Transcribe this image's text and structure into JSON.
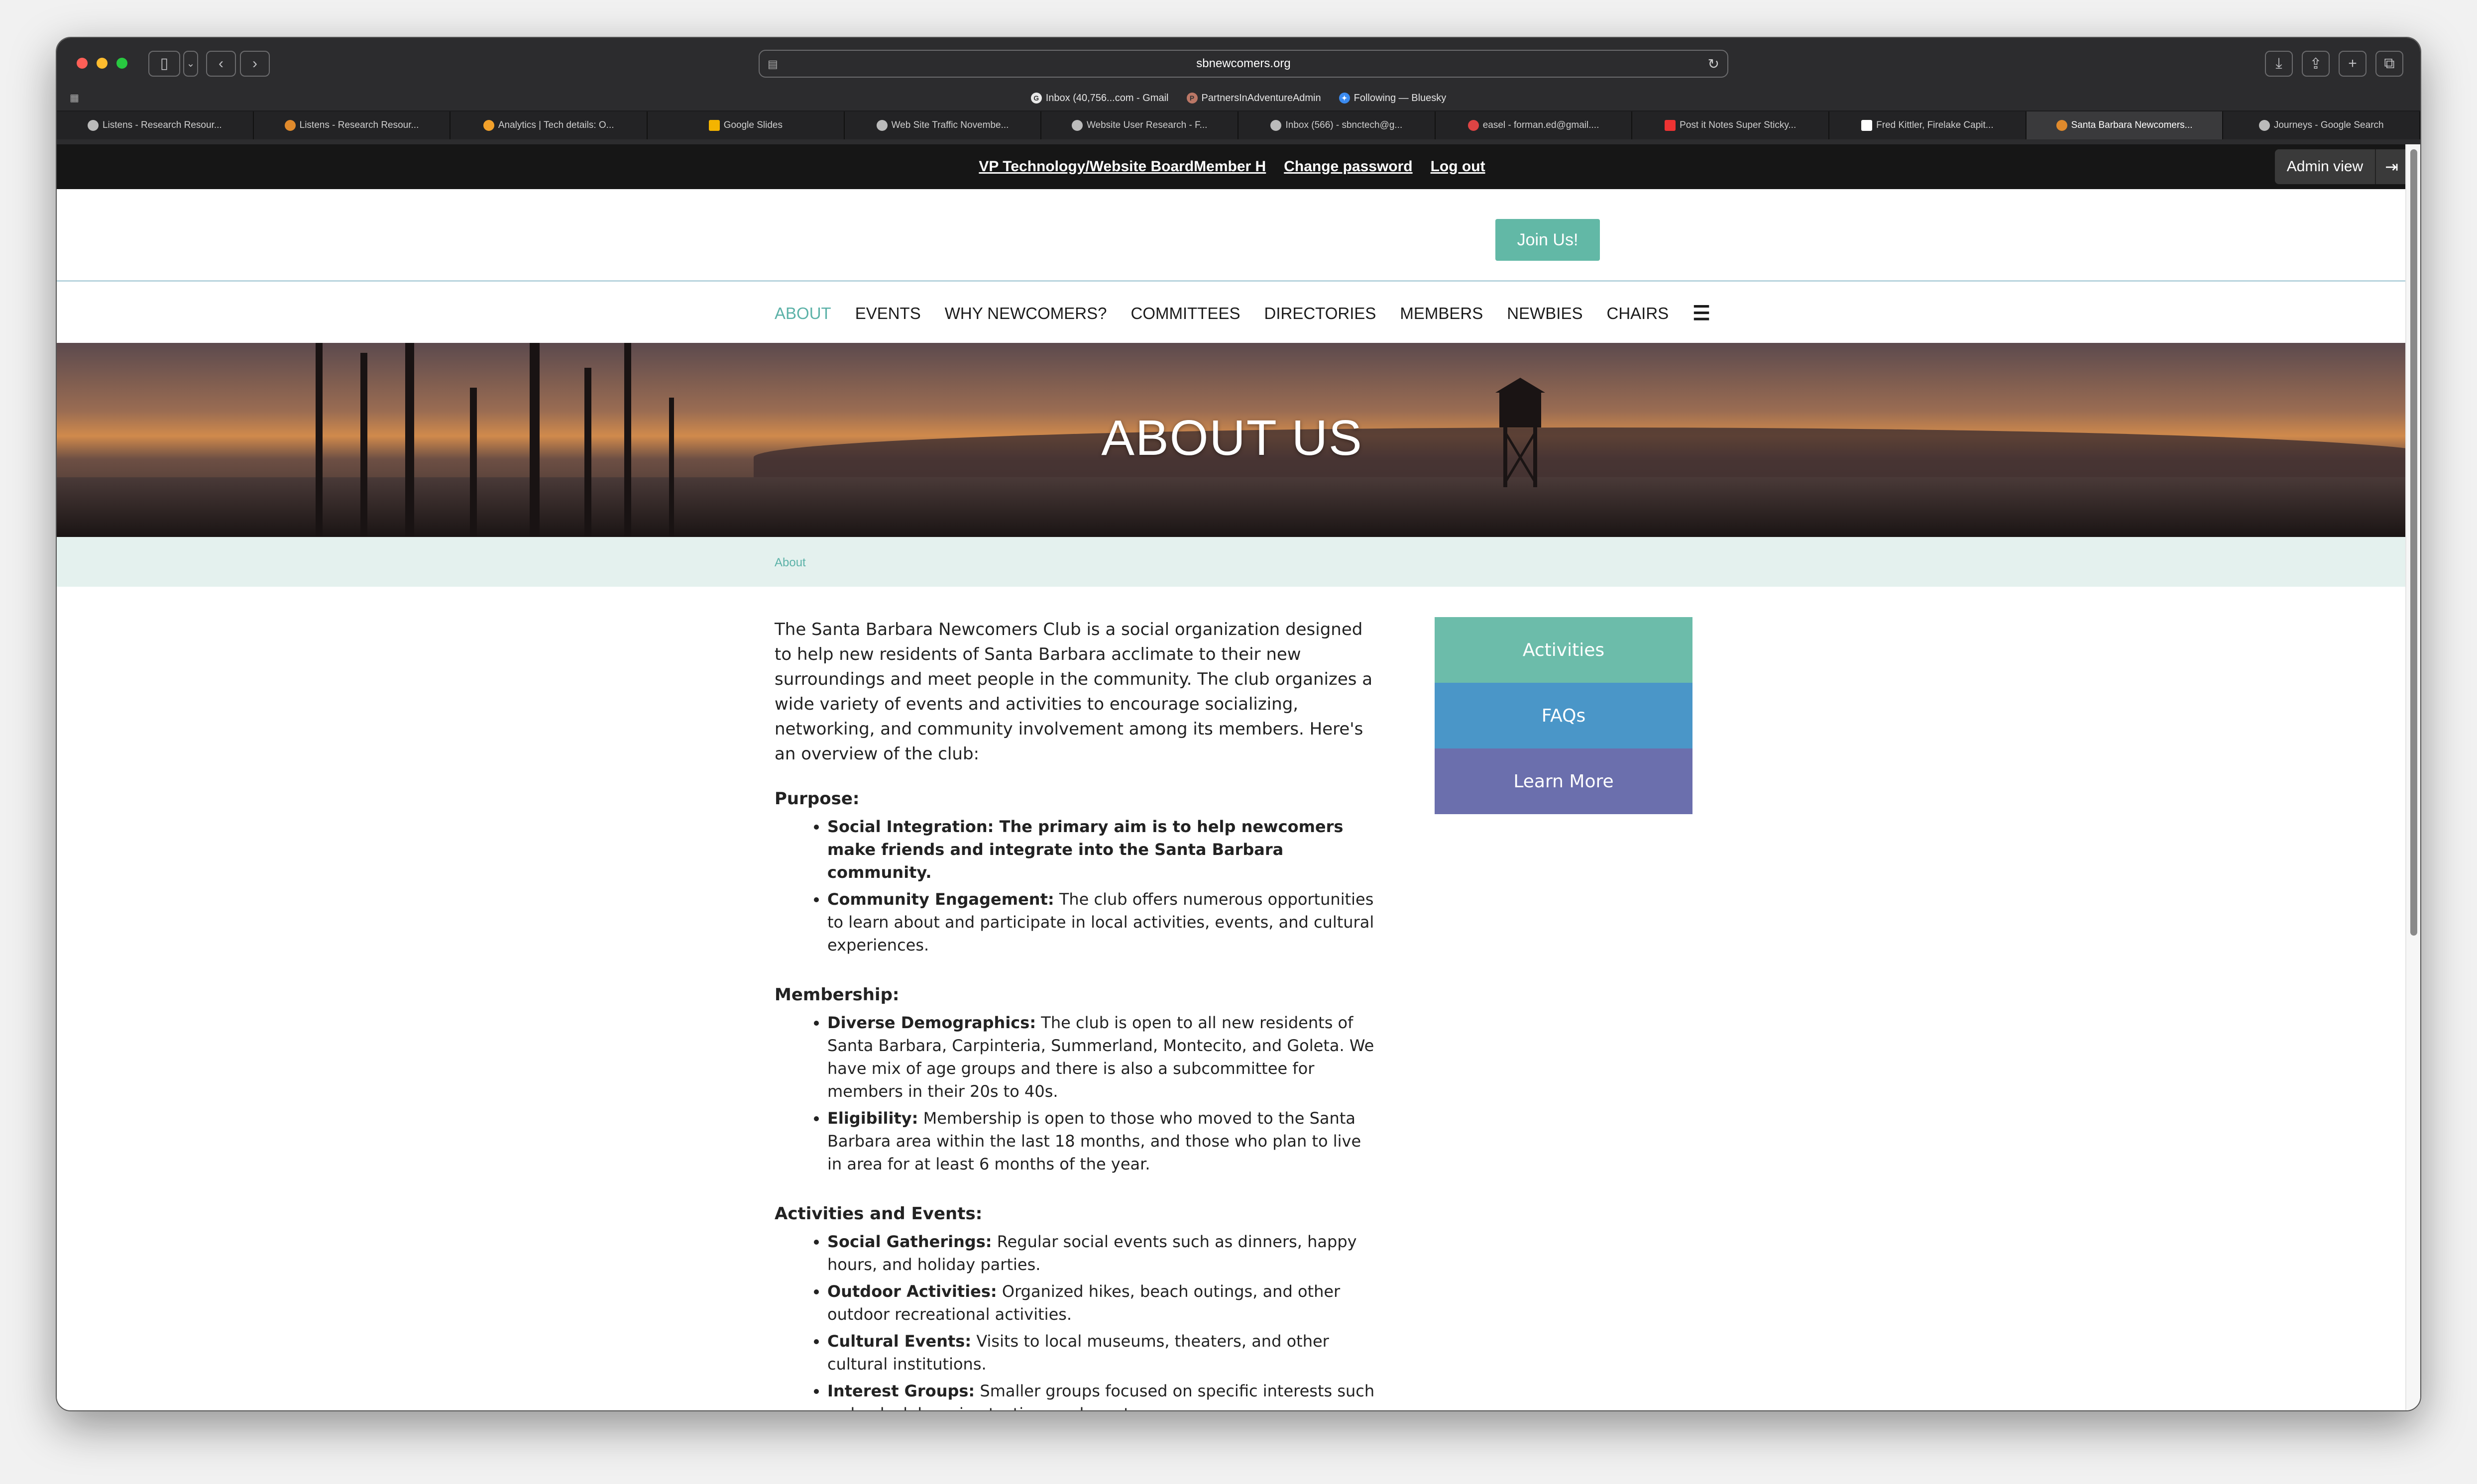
{
  "browser": {
    "url": "sbnewcomers.org",
    "favorites": [
      {
        "label": "Inbox (40,756...com - Gmail",
        "icon": "google-icon"
      },
      {
        "label": "PartnersInAdventureAdmin",
        "icon": "partners-icon"
      },
      {
        "label": "Following — Bluesky",
        "icon": "bluesky-icon"
      }
    ],
    "tabs": [
      {
        "label": "Listens - Research Resour..."
      },
      {
        "label": "Listens - Research Resour..."
      },
      {
        "label": "Analytics | Tech details: O..."
      },
      {
        "label": "Google Slides"
      },
      {
        "label": "Web Site Traffic Novembe..."
      },
      {
        "label": "Website User Research - F..."
      },
      {
        "label": "Inbox (566) - sbnctech@g..."
      },
      {
        "label": "easel - forman.ed@gmail...."
      },
      {
        "label": "Post it Notes Super Sticky..."
      },
      {
        "label": "Fred Kittler, Firelake Capit..."
      },
      {
        "label": "Santa Barbara Newcomers...",
        "active": true
      },
      {
        "label": "Journeys - Google Search"
      }
    ]
  },
  "admin": {
    "member": "VP Technology/Website BoardMember H",
    "change_password": "Change password",
    "logout": "Log out",
    "admin_view": "Admin view"
  },
  "header": {
    "join": "Join Us!"
  },
  "nav": {
    "items": [
      "ABOUT",
      "EVENTS",
      "WHY NEWCOMERS?",
      "COMMITTEES",
      "DIRECTORIES",
      "MEMBERS",
      "NEWBIES",
      "CHAIRS"
    ],
    "menu_icon": "hamburger-icon"
  },
  "hero": {
    "title": "ABOUT US"
  },
  "breadcrumb": {
    "current": "About"
  },
  "content": {
    "intro": "The Santa Barbara Newcomers Club is a social organization designed to help new residents of Santa Barbara acclimate to their new surroundings and meet people in the community. The club organizes a wide variety of events and activities to encourage socializing, networking, and community involvement among its members. Here's an overview of the club:",
    "purpose": {
      "heading": "Purpose:",
      "items": [
        {
          "term": "Social Integration:",
          "text": " The primary aim is to help newcomers make friends and integrate into the Santa Barbara community."
        },
        {
          "term": "Community Engagement:",
          "text": " The club offers numerous opportunities to learn about and participate in local activities, events, and cultural experiences."
        }
      ]
    },
    "membership": {
      "heading": "Membership:",
      "items": [
        {
          "term": "Diverse Demographics:",
          "text": " The club is open to all new residents of Santa Barbara, Carpinteria, Summerland, Montecito, and Goleta. We have mix of age groups and there is also a subcommittee for members in their 20s to 40s."
        },
        {
          "term": "Eligibility:",
          "text": " Membership is open to those who moved to the Santa Barbara area within the last 18 months, and those who plan to live in area for at least 6 months of the year."
        }
      ]
    },
    "activities": {
      "heading": "Activities and Events:",
      "items": [
        {
          "term": "Social Gatherings:",
          "text": " Regular social events such as dinners, happy hours, and holiday parties."
        },
        {
          "term": "Outdoor Activities:",
          "text": " Organized hikes, beach outings, and other outdoor recreational activities."
        },
        {
          "term": "Cultural Events:",
          "text": " Visits to local museums, theaters, and other cultural institutions."
        },
        {
          "term": "Interest Groups:",
          "text": " Smaller groups focused on specific interests such as book clubs, wine tasting, and sports."
        }
      ]
    }
  },
  "sidebar": {
    "buttons": [
      {
        "label": "Activities",
        "color": "#6cbcaa"
      },
      {
        "label": "FAQs",
        "color": "#4a96c8"
      },
      {
        "label": "Learn More",
        "color": "#6b6fad"
      }
    ]
  },
  "colors": {
    "accent": "#5cb2a8",
    "join_button": "#62b8a6"
  }
}
